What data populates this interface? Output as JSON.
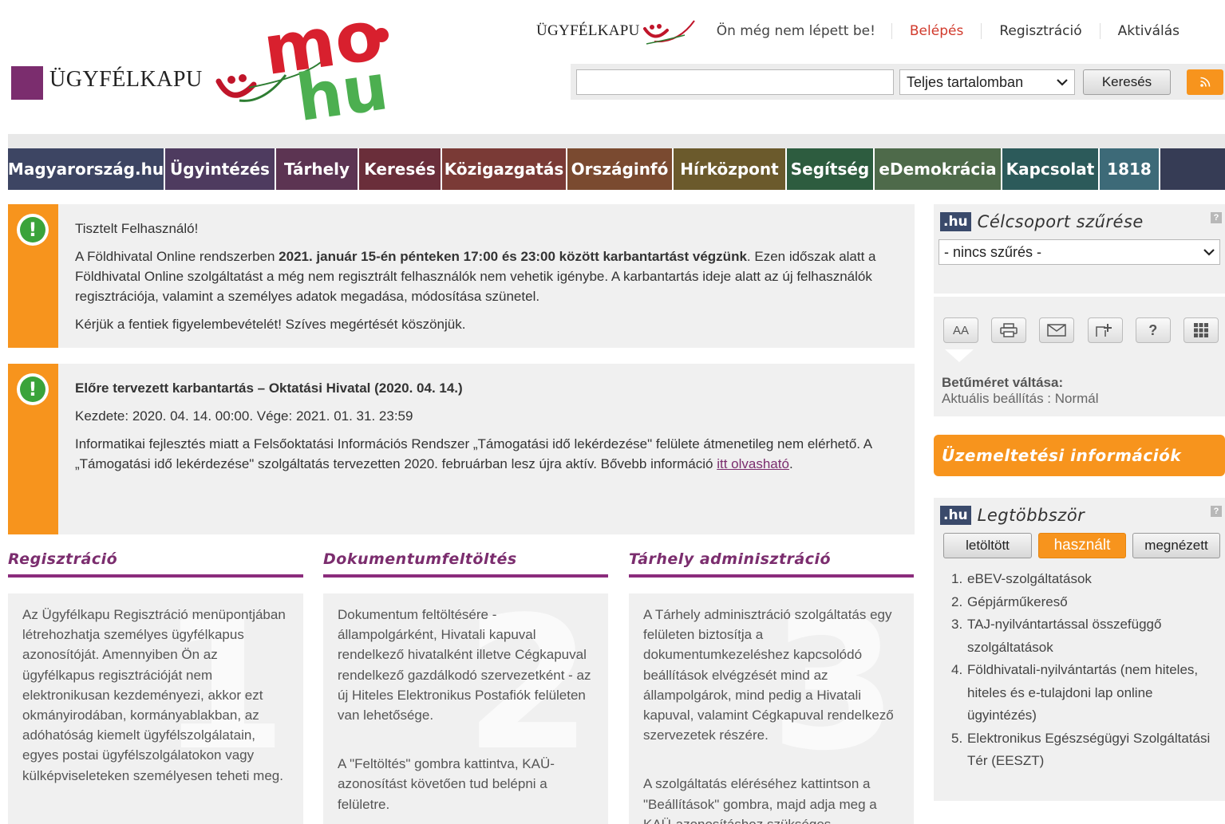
{
  "header": {
    "logo_text": "ÜGYFÉLKAPU",
    "mohu_text": "mo hu",
    "small_logo_text": "ÜGYFÉLKAPU",
    "login_status": "Ön még nem lépett be!",
    "login_link": "Belépés",
    "register_link": "Regisztráció",
    "activate_link": "Aktiválás"
  },
  "search": {
    "value": "",
    "scope_selected": "Teljes tartalomban",
    "button": "Keresés",
    "rss_icon": "rss-icon"
  },
  "nav": {
    "items": [
      {
        "label": "Magyarország.hu",
        "color": "#3d4563"
      },
      {
        "label": "Ügyintézés",
        "color": "#4e3b5f"
      },
      {
        "label": "Tárhely",
        "color": "#5c3452"
      },
      {
        "label": "Keresés",
        "color": "#6a2e3a"
      },
      {
        "label": "Közigazgatás",
        "color": "#7a3a36"
      },
      {
        "label": "Országinfó",
        "color": "#7a4a30"
      },
      {
        "label": "Hírközpont",
        "color": "#6b5a2c"
      },
      {
        "label": "Segítség",
        "color": "#2d5c3f"
      },
      {
        "label": "eDemokrácia",
        "color": "#4e6a4a"
      },
      {
        "label": "Kapcsolat",
        "color": "#2c5a5a"
      },
      {
        "label": "1818",
        "color": "#3d6a78"
      }
    ],
    "tail_color": "#363c55"
  },
  "notice1": {
    "greeting": "Tisztelt Felhasználó!",
    "text_before": "A Földhivatal Online rendszerben ",
    "text_bold": "2021. január 15-én pénteken 17:00 és 23:00 között karbantartást végzünk",
    "text_after": ". Ezen időszak alatt a Földhivatal Online szolgáltatást a még nem regisztrált felhasználók nem vehetik igénybe. A karbantartás ideje alatt az új felhasználók regisztrációja, valamint a személyes adatok megadása, módosítása szünetel.",
    "closing": "Kérjük a fentiek figyelembevételét! Szíves megértését köszönjük."
  },
  "notice2": {
    "title": "Előre tervezett karbantartás – Oktatási Hivatal (2020. 04. 14.)",
    "dates": "Kezdete: 2020. 04. 14. 00:00. Vége: 2021. 01. 31. 23:59",
    "text": "Informatikai fejlesztés miatt a Felsőoktatási Információs Rendszer „Támogatási idő lekérdezése\" felülete átmenetileg nem elérhető. A „Támogatási idő lekérdezése\" szolgáltatás tervezetten 2020. februárban lesz újra aktív. Bővebb információ ",
    "link": "itt olvasható",
    "end": "."
  },
  "columns": [
    {
      "title": "Regisztráció",
      "number": "1",
      "paragraphs": [
        "Az Ügyfélkapu Regisztráció menüpontjában létrehozhatja személyes ügyfélkapus azonosítóját. Amennyiben Ön az ügyfélkapus regisztrációját nem elektronikusan kezdeményezi, akkor ezt okmányirodában, kormányablakban, az adóhatóság kiemelt ügyfélszolgálatain, egyes postai ügyfélszolgálatokon vagy külképviseleteken személyesen teheti meg."
      ]
    },
    {
      "title": "Dokumentumfeltöltés",
      "number": "2",
      "paragraphs": [
        "Dokumentum feltöltésére - állampolgárként, Hivatali kapuval rendelkező hivatalként illetve Cégkapuval rendelkező gazdálkodó szervezetként - az új Hiteles Elektronikus Postafiók felületen van lehetősége.",
        "A \"Feltöltés\" gombra kattintva, KAÜ-azonosítást követően tud belépni a felületre."
      ]
    },
    {
      "title": "Tárhely adminisztráció",
      "number": "3",
      "paragraphs": [
        "A Tárhely adminisztráció szolgáltatás egy felületen biztosítja a dokumentumkezeléshez kapcsolódó beállítások elvégzését mind az állampolgárok, mind pedig a Hivatali kapuval, valamint Cégkapuval rendelkező szervezetek részére.",
        "A szolgáltatás eléréséhez kattintson a \"Beállítások\" gombra, majd adja meg a KAÜ-azonosításhoz szükséges"
      ]
    }
  ],
  "sidebar": {
    "hu_badge": ".hu",
    "filter_title": "Célcsoport szűrése",
    "filter_selected": "- nincs szűrés -",
    "help": "?",
    "tools": {
      "font": "AA",
      "help": "?"
    },
    "font_label": "Betűméret váltása:",
    "font_value": "Aktuális beállítás : Normál",
    "ops_title": "Üzemeltetési információk",
    "popular_title": "Legtöbbször",
    "tabs": [
      "letöltött",
      "használt",
      "megnézett"
    ],
    "active_tab": "használt",
    "popular_items": [
      "eBEV-szolgáltatások",
      "Gépjárműkereső",
      "TAJ-nyilvántartással összefüggő szolgáltatások",
      "Földhivatali-nyilvántartás (nem hiteles, hiteles és e-tulajdoni lap online ügyintézés)",
      "Elektronikus Egészségügyi Szolgáltatási Tér (EESZT)"
    ]
  }
}
